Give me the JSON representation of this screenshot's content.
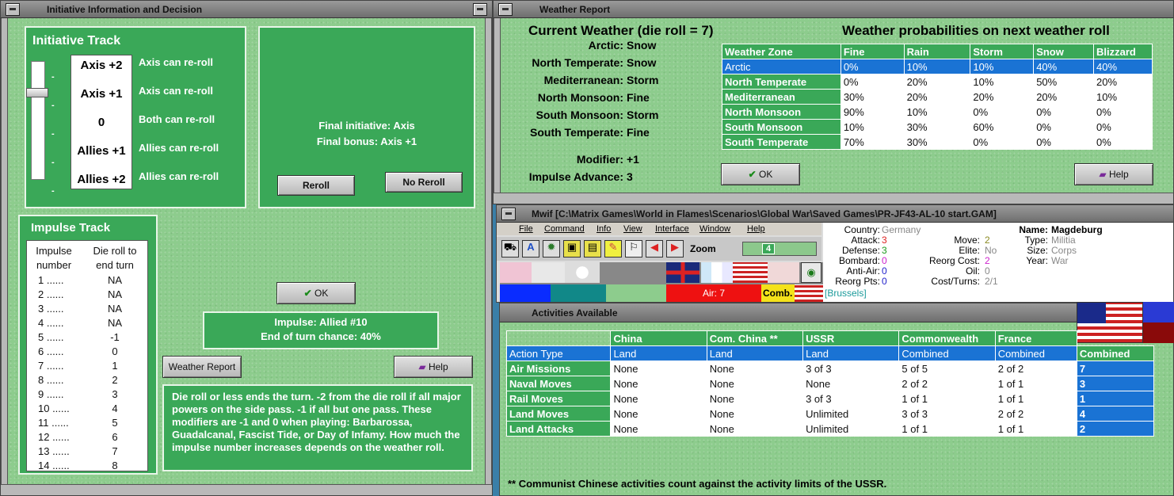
{
  "initiative_window": {
    "title": "Initiative Information and Decision",
    "track_title": "Initiative Track",
    "track_levels": [
      {
        "label": "Axis +2",
        "desc": "Axis can re-roll"
      },
      {
        "label": "Axis +1",
        "desc": "Axis can re-roll"
      },
      {
        "label": "0",
        "desc": "Both can re-roll"
      },
      {
        "label": "Allies +1",
        "desc": "Allies can re-roll"
      },
      {
        "label": "Allies +2",
        "desc": "Allies can re-roll"
      }
    ],
    "final_initiative": "Final initiative: Axis",
    "final_bonus": "Final bonus: Axis +1",
    "reroll_label": "Reroll",
    "noreroll_label": "No Reroll",
    "impulse_title": "Impulse Track",
    "impulse_col1": "Impulse number",
    "impulse_col2": "Die roll to end turn",
    "impulse_rows": [
      [
        "1 ......",
        "NA"
      ],
      [
        "2 ......",
        "NA"
      ],
      [
        "3 ......",
        "NA"
      ],
      [
        "4 ......",
        "NA"
      ],
      [
        "5 ......",
        "-1"
      ],
      [
        "6 ......",
        "0"
      ],
      [
        "7 ......",
        "1"
      ],
      [
        "8 ......",
        "2"
      ],
      [
        "9 ......",
        "3"
      ],
      [
        "10 ......",
        "4"
      ],
      [
        "11 ......",
        "5"
      ],
      [
        "12 ......",
        "6"
      ],
      [
        "13 ......",
        "7"
      ],
      [
        "14 ......",
        "8"
      ]
    ],
    "ok_label": "OK",
    "impulse_status": "Impulse: Allied #10",
    "end_chance": "End of turn chance: 40%",
    "weather_report_label": "Weather Report",
    "help_label": "Help",
    "info_text": "Die roll or less ends the turn.  -2 from the die roll if all major powers on the side pass.  -1 if all but one pass.  These modifiers are -1 and 0 when playing: Barbarossa, Guadalcanal, Fascist Tide, or Day of Infamy.  How much the impulse number increases depends on the weather roll."
  },
  "weather_window": {
    "title": "Weather Report",
    "current_title": "Current Weather (die roll = 7)",
    "prob_title": "Weather probabilities on next weather roll",
    "current": [
      {
        "zone": "Arctic:",
        "value": "Snow"
      },
      {
        "zone": "North Temperate:",
        "value": "Snow"
      },
      {
        "zone": "Mediterranean:",
        "value": "Storm"
      },
      {
        "zone": "North Monsoon:",
        "value": "Fine"
      },
      {
        "zone": "South Monsoon:",
        "value": "Storm"
      },
      {
        "zone": "South Temperate:",
        "value": "Fine"
      }
    ],
    "modifier_label": "Modifier:",
    "modifier_value": "+1",
    "advance_label": "Impulse Advance:",
    "advance_value": "3",
    "table_headers": [
      "Weather Zone",
      "Fine",
      "Rain",
      "Storm",
      "Snow",
      "Blizzard"
    ],
    "table_rows": [
      [
        "Arctic",
        "0%",
        "10%",
        "10%",
        "40%",
        "40%"
      ],
      [
        "North Temperate",
        "0%",
        "20%",
        "10%",
        "50%",
        "20%"
      ],
      [
        "Mediterranean",
        "30%",
        "20%",
        "20%",
        "20%",
        "10%"
      ],
      [
        "North Monsoon",
        "90%",
        "10%",
        "0%",
        "0%",
        "0%"
      ],
      [
        "South Monsoon",
        "10%",
        "30%",
        "60%",
        "0%",
        "0%"
      ],
      [
        "South Temperate",
        "70%",
        "30%",
        "0%",
        "0%",
        "0%"
      ]
    ],
    "ok_label": "OK",
    "help_label": "Help"
  },
  "main_window": {
    "title": "Mwif [C:\\Matrix Games\\World in Flames\\Scenarios\\Global War\\Saved Games\\PR-JF43-AL-10 start.GAM]",
    "menu": [
      "File",
      "Command",
      "Info",
      "View",
      "Interface",
      "Window",
      "Help"
    ],
    "zoom_label": "Zoom",
    "zoom_value": "4",
    "air_label": "Air: 7",
    "comb_label": "Comb.",
    "unit": {
      "country_label": "Country:",
      "country": "Germany",
      "attack_label": "Attack:",
      "attack": "3",
      "defense_label": "Defense:",
      "defense": "3",
      "bombard_label": "Bombard:",
      "bombard": "0",
      "antiair_label": "Anti-Air:",
      "antiair": "0",
      "reorgpts_label": "Reorg Pts:",
      "reorgpts": "0",
      "move_label": "Move:",
      "move": "2",
      "elite_label": "Elite:",
      "elite": "No",
      "reorgcost_label": "Reorg Cost:",
      "reorgcost": "2",
      "oil_label": "Oil:",
      "oil": "0",
      "costturns_label": "Cost/Turns:",
      "costturns": "2/1",
      "name_label": "Name:",
      "name": "Magdeburg",
      "type_label": "Type:",
      "type": "Militia",
      "size_label": "Size:",
      "size": "Corps",
      "year_label": "Year:",
      "year": "War",
      "location": "[Brussels]"
    }
  },
  "activities_window": {
    "title": "Activities Available",
    "headers": [
      "",
      "China",
      "Com. China **",
      "USSR",
      "Commonwealth",
      "France",
      "Combined"
    ],
    "rows": [
      [
        "Action Type",
        "Land",
        "Land",
        "Land",
        "Combined",
        "Combined",
        ""
      ],
      [
        "Air Missions",
        "None",
        "None",
        "3 of 3",
        "5 of 5",
        "2 of 2",
        "7"
      ],
      [
        "Naval Moves",
        "None",
        "None",
        "None",
        "2 of 2",
        "1 of 1",
        "3"
      ],
      [
        "Rail Moves",
        "None",
        "None",
        "3 of 3",
        "1 of 1",
        "1 of 1",
        "1"
      ],
      [
        "Land Moves",
        "None",
        "None",
        "Unlimited",
        "3 of 3",
        "2 of 2",
        "4"
      ],
      [
        "Land Attacks",
        "None",
        "None",
        "Unlimited",
        "1 of 1",
        "1 of 1",
        "2"
      ]
    ],
    "footnote": "** Communist Chinese activities count against the activity limits of the USSR."
  },
  "colors": {
    "panel_green": "#3aa858",
    "felt_green": "#8dcc8d",
    "select_blue": "#1a73d4"
  }
}
